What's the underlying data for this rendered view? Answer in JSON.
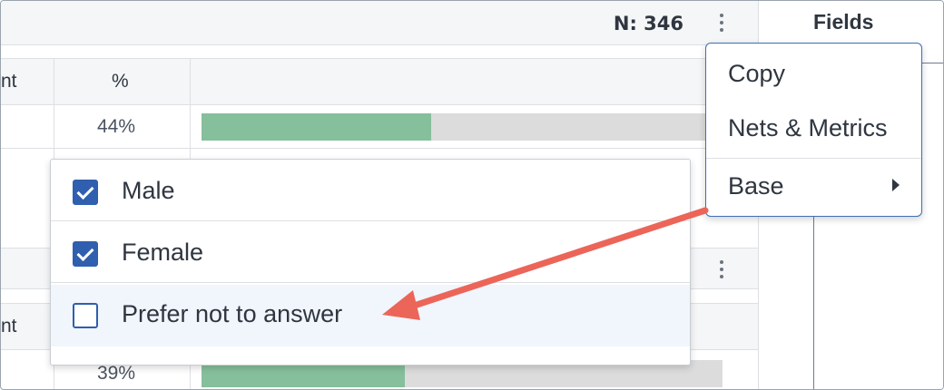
{
  "header": {
    "n_count": "N: 346"
  },
  "table1": {
    "col_count_partial": "nt",
    "col_percent": "%",
    "rows": [
      {
        "percent": "44%",
        "bar_fraction": 0.44
      }
    ]
  },
  "table2": {
    "col_count_partial": "nt",
    "rows": [
      {
        "percent": "39%",
        "bar_fraction": 0.39
      }
    ]
  },
  "fields_panel": {
    "title": "Fields"
  },
  "context_menu": {
    "items": [
      {
        "label": "Copy"
      },
      {
        "label": "Nets & Metrics"
      },
      {
        "label": "Base"
      }
    ]
  },
  "base_options": [
    {
      "label": "Male",
      "checked": true
    },
    {
      "label": "Female",
      "checked": true
    },
    {
      "label": "Prefer not to answer",
      "checked": false
    }
  ],
  "colors": {
    "accent": "#2f5fae",
    "bar_fill": "#86bf9b",
    "bar_track": "#dcdcdc",
    "annotation_arrow": "#ec6559",
    "menu_border": "#3e6fb3"
  }
}
